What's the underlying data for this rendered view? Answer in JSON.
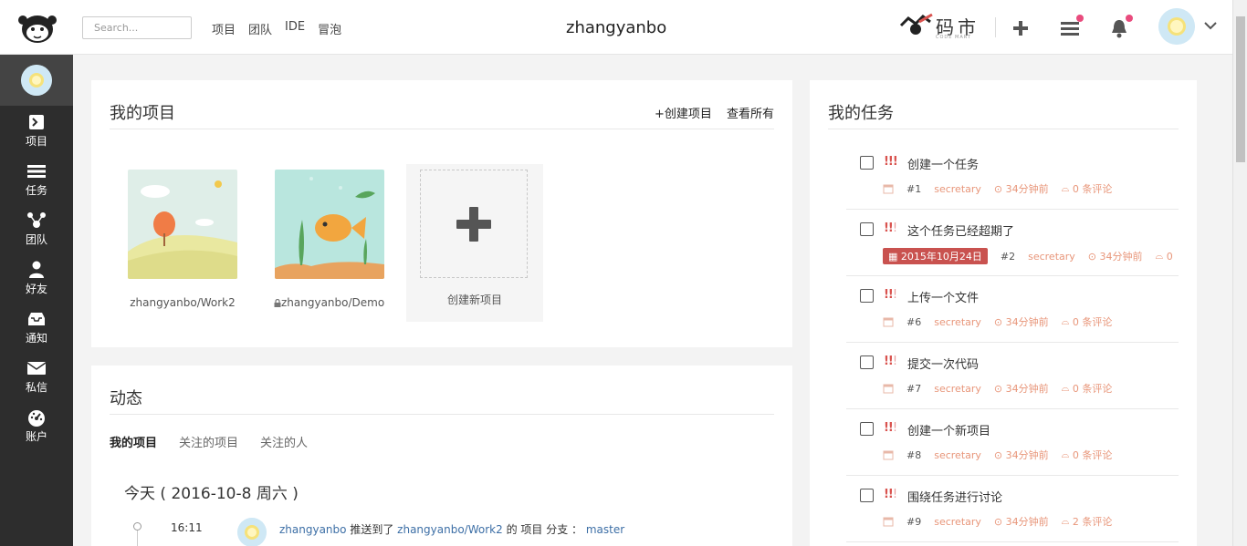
{
  "header": {
    "search_placeholder": "Search...",
    "nav": [
      "项目",
      "团队",
      "IDE",
      "冒泡"
    ],
    "user_title": "zhangyanbo",
    "brand": "码市",
    "brand_sub": "CODE MART"
  },
  "sidebar": {
    "items": [
      {
        "label": "项目",
        "icon": "project-icon"
      },
      {
        "label": "任务",
        "icon": "tasks-icon"
      },
      {
        "label": "团队",
        "icon": "team-icon"
      },
      {
        "label": "好友",
        "icon": "friend-icon"
      },
      {
        "label": "通知",
        "icon": "inbox-icon"
      },
      {
        "label": "私信",
        "icon": "mail-icon"
      },
      {
        "label": "账户",
        "icon": "dashboard-icon"
      }
    ]
  },
  "projects": {
    "title": "我的项目",
    "create_label": "+创建项目",
    "view_all_label": "查看所有",
    "items": [
      {
        "name": "zhangyanbo/Work2",
        "private": false
      },
      {
        "name": "zhangyanbo/Demo",
        "private": true
      }
    ],
    "new_label": "创建新项目"
  },
  "activity": {
    "title": "动态",
    "tabs": [
      "我的项目",
      "关注的项目",
      "关注的人"
    ],
    "date": "今天 ( 2016-10-8 周六 )",
    "entries": [
      {
        "time": "16:11",
        "user": "zhangyanbo",
        "action": "推送到了",
        "project": "zhangyanbo/Work2",
        "suffix": "的 项目 分支 ：",
        "branch": "master"
      }
    ]
  },
  "tasks": {
    "title": "我的任务",
    "items": [
      {
        "title": "创建一个任务",
        "num": "#1",
        "owner": "secretary",
        "time": "34分钟前",
        "comments": "0 条评论",
        "due": ""
      },
      {
        "title": "这个任务已经超期了",
        "num": "#2",
        "owner": "secretary",
        "time": "34分钟前",
        "comments": "0",
        "due": "2015年10月24日"
      },
      {
        "title": "上传一个文件",
        "num": "#6",
        "owner": "secretary",
        "time": "34分钟前",
        "comments": "0 条评论",
        "due": ""
      },
      {
        "title": "提交一次代码",
        "num": "#7",
        "owner": "secretary",
        "time": "34分钟前",
        "comments": "0 条评论",
        "due": ""
      },
      {
        "title": "创建一个新项目",
        "num": "#8",
        "owner": "secretary",
        "time": "34分钟前",
        "comments": "0 条评论",
        "due": ""
      },
      {
        "title": "围绕任务进行讨论",
        "num": "#9",
        "owner": "secretary",
        "time": "34分钟前",
        "comments": "2 条评论",
        "due": ""
      }
    ]
  },
  "colors": {
    "accent_red": "#c9524f",
    "meta_orange": "#e8967a",
    "link_blue": "#3d6fa6",
    "sidebar_bg": "#2d2d2d",
    "notify_dot": "#e94b7d"
  }
}
